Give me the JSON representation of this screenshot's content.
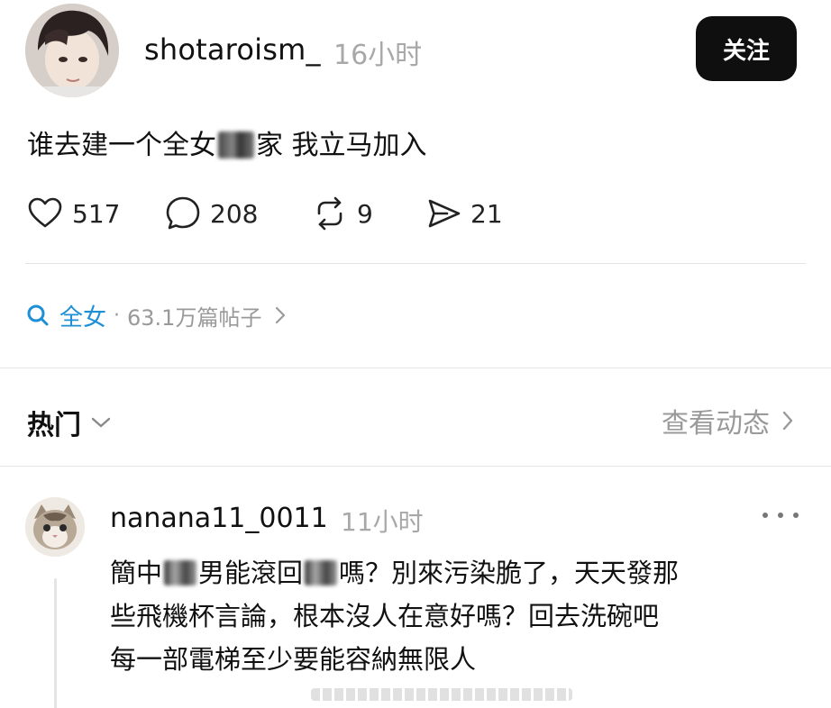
{
  "post": {
    "username": "shotaroism_",
    "time": "16小时",
    "follow_label": "关注",
    "text_before": "谁去建一个全女",
    "text_after": "家 我立马加入",
    "likes": "517",
    "replies": "208",
    "reposts": "9",
    "shares": "21"
  },
  "topic": {
    "name": "全女",
    "dot": "·",
    "count": "63.1万篇帖子"
  },
  "section": {
    "hot_label": "热门",
    "activity_label": "查看动态"
  },
  "comment": {
    "username": "nanana11_0011",
    "time": "11小时",
    "line1_a": "簡中",
    "line1_b": "男能滾回",
    "line1_c": "嗎？別來污染脆了，天天發那",
    "line2": "些飛機杯言論，根本沒人在意好嗎？回去洗碗吧",
    "line3": "每一部電梯至少要能容納無限人"
  },
  "colors": {
    "accent": "#1d8fd6",
    "button_bg": "#0f0f0f",
    "muted": "#a8a8a8"
  },
  "icons": {
    "like": "heart-icon",
    "reply": "speech-bubble-icon",
    "repost": "repost-icon",
    "share": "send-icon",
    "search": "search-icon",
    "chevron": "chevron-right-icon",
    "dropdown": "chevron-down-icon",
    "more": "more-dots-icon"
  }
}
